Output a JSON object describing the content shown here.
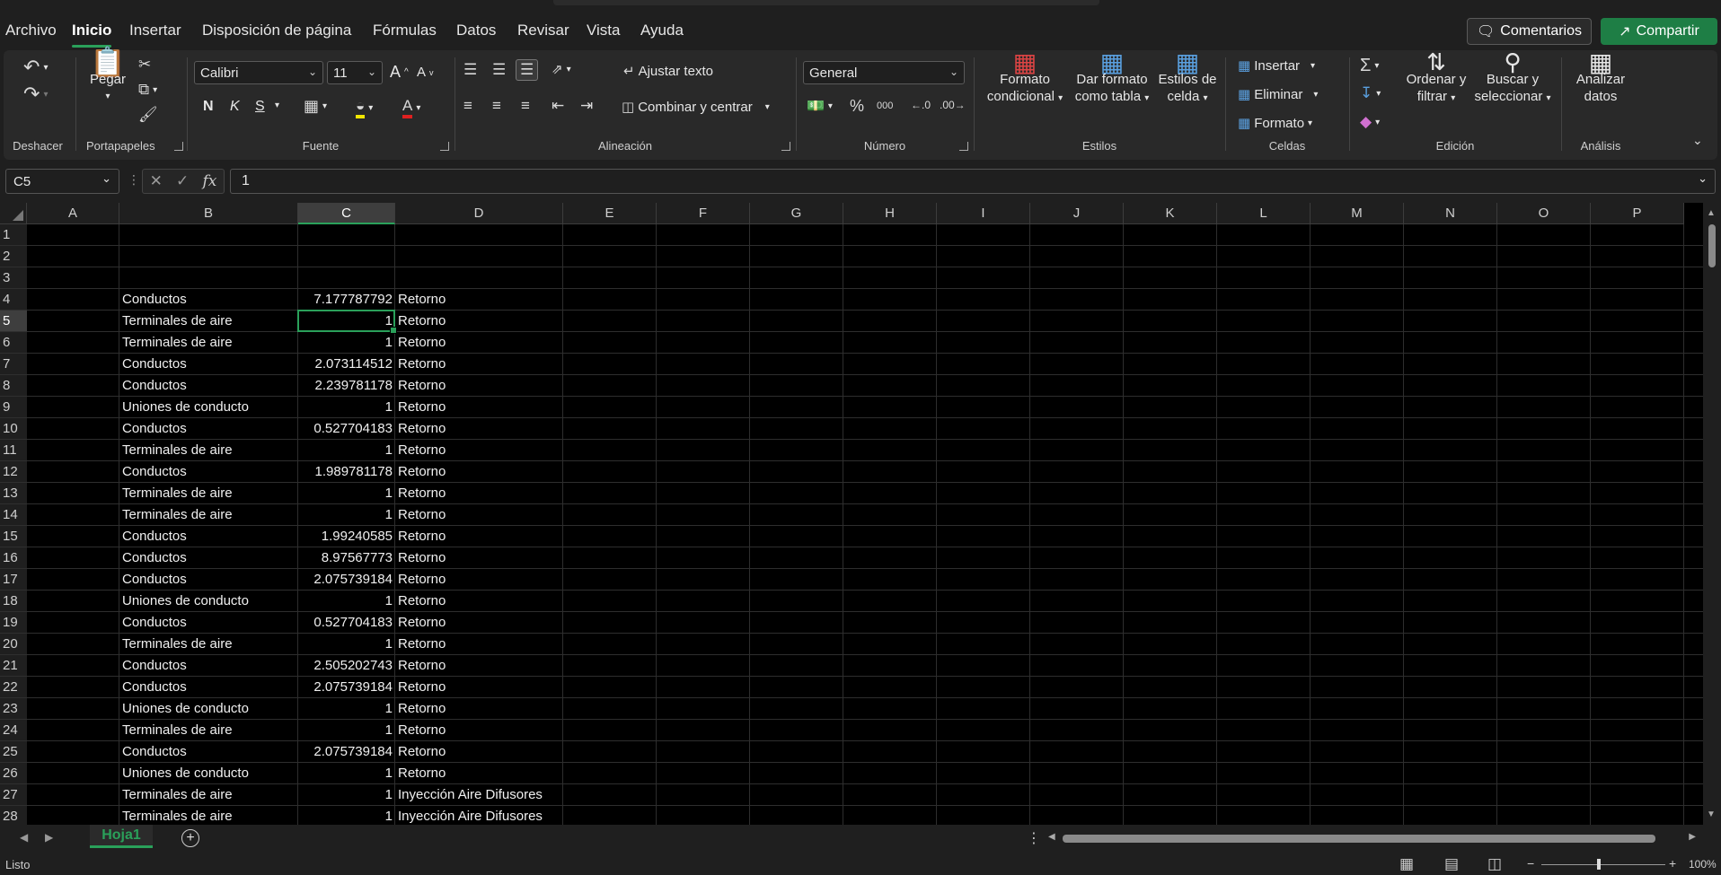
{
  "menu": {
    "tabs": [
      "Archivo",
      "Inicio",
      "Insertar",
      "Disposición de página",
      "Fórmulas",
      "Datos",
      "Revisar",
      "Vista",
      "Ayuda"
    ],
    "active": "Inicio",
    "comentarios": "Comentarios",
    "compartir": "Compartir"
  },
  "ribbon": {
    "deshacer": "Deshacer",
    "portapapeles": "Portapapeles",
    "pegar": "Pegar",
    "fuente": "Fuente",
    "font_name": "Calibri",
    "font_size": "11",
    "bold": "N",
    "italic": "K",
    "underline": "S",
    "alineacion": "Alineación",
    "ajustar_texto": "Ajustar texto",
    "combinar": "Combinar y centrar",
    "numero": "Número",
    "number_format": "General",
    "estilos": "Estilos",
    "formato_condicional_1": "Formato",
    "formato_condicional_2": "condicional",
    "dar_formato_1": "Dar formato",
    "dar_formato_2": "como tabla",
    "estilos_celda_1": "Estilos de",
    "estilos_celda_2": "celda",
    "celdas": "Celdas",
    "insertar": "Insertar",
    "eliminar": "Eliminar",
    "formato": "Formato",
    "edicion": "Edición",
    "ordenar_1": "Ordenar y",
    "ordenar_2": "filtrar",
    "buscar_1": "Buscar y",
    "buscar_2": "seleccionar",
    "analisis": "Análisis",
    "analizar_1": "Analizar",
    "analizar_2": "datos"
  },
  "formula_bar": {
    "name_box": "C5",
    "value": "1"
  },
  "columns": [
    "A",
    "B",
    "C",
    "D",
    "E",
    "F",
    "G",
    "H",
    "I",
    "J",
    "K",
    "L",
    "M",
    "N",
    "O",
    "P"
  ],
  "selected_column": "C",
  "selected_row": 5,
  "rows": [
    {
      "n": 1,
      "b": "",
      "c": "",
      "d": ""
    },
    {
      "n": 2,
      "b": "",
      "c": "",
      "d": ""
    },
    {
      "n": 3,
      "b": "",
      "c": "",
      "d": ""
    },
    {
      "n": 4,
      "b": "Conductos",
      "c": "7.177787792",
      "d": "Retorno"
    },
    {
      "n": 5,
      "b": "Terminales de aire",
      "c": "1",
      "d": "Retorno"
    },
    {
      "n": 6,
      "b": "Terminales de aire",
      "c": "1",
      "d": "Retorno"
    },
    {
      "n": 7,
      "b": "Conductos",
      "c": "2.073114512",
      "d": "Retorno"
    },
    {
      "n": 8,
      "b": "Conductos",
      "c": "2.239781178",
      "d": "Retorno"
    },
    {
      "n": 9,
      "b": "Uniones de conducto",
      "c": "1",
      "d": "Retorno"
    },
    {
      "n": 10,
      "b": "Conductos",
      "c": "0.527704183",
      "d": "Retorno"
    },
    {
      "n": 11,
      "b": "Terminales de aire",
      "c": "1",
      "d": "Retorno"
    },
    {
      "n": 12,
      "b": "Conductos",
      "c": "1.989781178",
      "d": "Retorno"
    },
    {
      "n": 13,
      "b": "Terminales de aire",
      "c": "1",
      "d": "Retorno"
    },
    {
      "n": 14,
      "b": "Terminales de aire",
      "c": "1",
      "d": "Retorno"
    },
    {
      "n": 15,
      "b": "Conductos",
      "c": "1.99240585",
      "d": "Retorno"
    },
    {
      "n": 16,
      "b": "Conductos",
      "c": "8.97567773",
      "d": "Retorno"
    },
    {
      "n": 17,
      "b": "Conductos",
      "c": "2.075739184",
      "d": "Retorno"
    },
    {
      "n": 18,
      "b": "Uniones de conducto",
      "c": "1",
      "d": "Retorno"
    },
    {
      "n": 19,
      "b": "Conductos",
      "c": "0.527704183",
      "d": "Retorno"
    },
    {
      "n": 20,
      "b": "Terminales de aire",
      "c": "1",
      "d": "Retorno"
    },
    {
      "n": 21,
      "b": "Conductos",
      "c": "2.505202743",
      "d": "Retorno"
    },
    {
      "n": 22,
      "b": "Conductos",
      "c": "2.075739184",
      "d": "Retorno"
    },
    {
      "n": 23,
      "b": "Uniones de conducto",
      "c": "1",
      "d": "Retorno"
    },
    {
      "n": 24,
      "b": "Terminales de aire",
      "c": "1",
      "d": "Retorno"
    },
    {
      "n": 25,
      "b": "Conductos",
      "c": "2.075739184",
      "d": "Retorno"
    },
    {
      "n": 26,
      "b": "Uniones de conducto",
      "c": "1",
      "d": "Retorno"
    },
    {
      "n": 27,
      "b": "Terminales de aire",
      "c": "1",
      "d": "Inyección Aire Difusores"
    },
    {
      "n": 28,
      "b": "Terminales de aire",
      "c": "1",
      "d": "Inyección Aire Difusores"
    }
  ],
  "sheet": {
    "tabs": [
      "Hoja1"
    ]
  },
  "status": {
    "ready": "Listo",
    "zoom": "100%"
  }
}
